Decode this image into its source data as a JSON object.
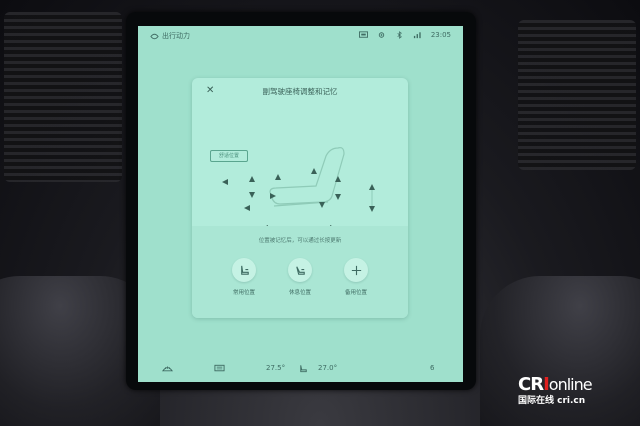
{
  "status_bar": {
    "app_title": "出行动力",
    "time": "23:05"
  },
  "dialog": {
    "title": "副驾驶座椅调整和记忆",
    "close_label": "✕",
    "position_tag": "舒适位置",
    "hint": "位置被记忆后，可以通过长按更新",
    "buttons": [
      {
        "label": "常用位置"
      },
      {
        "label": "休息位置"
      },
      {
        "label": "备用位置"
      }
    ]
  },
  "bottom_bar": {
    "temp_left": "27.5°",
    "temp_right": "27.0°",
    "right_value": "6"
  },
  "watermark": {
    "logo_cr": "CR",
    "logo_i": "I",
    "logo_online": "online",
    "subtitle": "国际在线 cri.cn"
  },
  "colors": {
    "screen_bg": "#9fe0cc",
    "card_bg": "#b2ecdb",
    "accent": "#3e6b62"
  }
}
